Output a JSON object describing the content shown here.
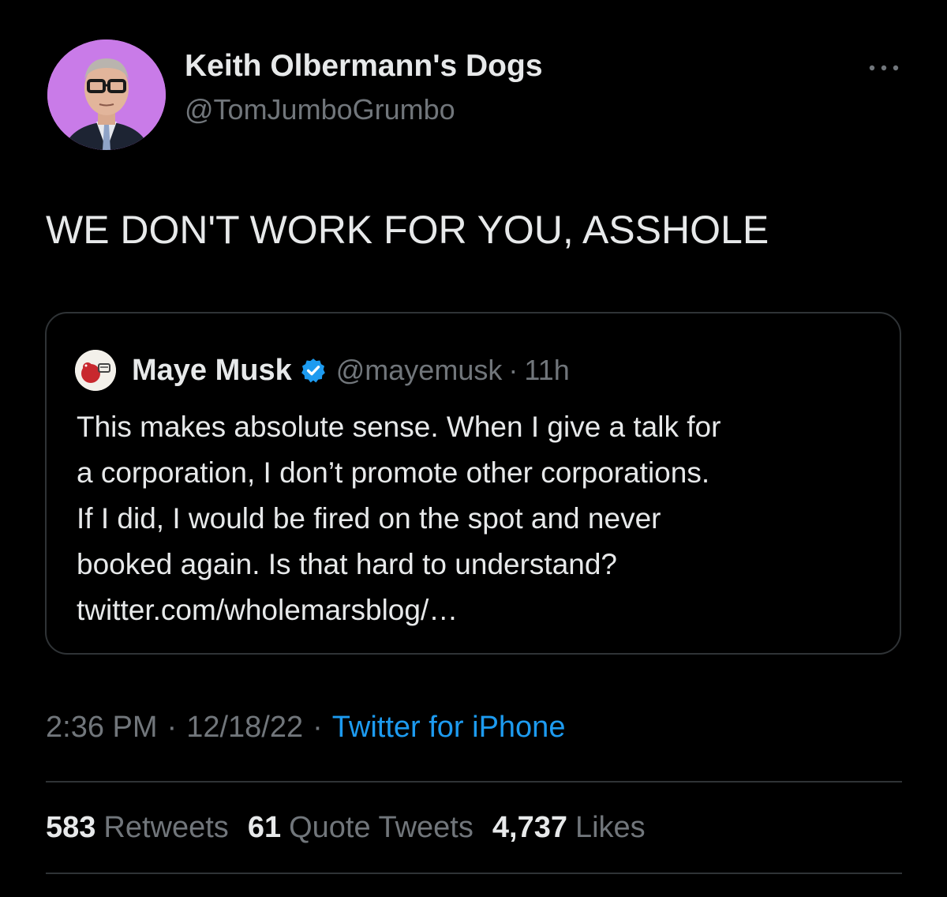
{
  "author": {
    "display_name": "Keith Olbermann's Dogs",
    "handle": "@TomJumboGrumbo",
    "avatar_icon": "profile-photo-man-glasses",
    "avatar_bg": "#c97be8"
  },
  "tweet": {
    "text": "WE DON'T WORK FOR YOU, ASSHOLE"
  },
  "quote": {
    "display_name": "Maye Musk",
    "verified": true,
    "handle": "@mayemusk",
    "separator": "·",
    "time": "11h",
    "lines": [
      "This makes absolute sense. When I give a talk for",
      "a corporation, I don’t promote other corporations.",
      "If I did, I would be fired on the spot and never",
      "booked again. Is that hard to understand?",
      "twitter.com/wholemarsblog/…"
    ]
  },
  "meta": {
    "time": "2:36 PM",
    "separator": "·",
    "date": "12/18/22",
    "source": "Twitter for iPhone"
  },
  "stats": {
    "retweets_count": "583",
    "retweets_label": "Retweets",
    "quotes_count": "61",
    "quotes_label": "Quote Tweets",
    "likes_count": "4,737",
    "likes_label": "Likes"
  },
  "colors": {
    "background": "#000000",
    "text_primary": "#e7e9ea",
    "text_secondary": "#71767b",
    "link": "#1d9bf0",
    "border": "#2f3336",
    "verified": "#1d9bf0"
  }
}
